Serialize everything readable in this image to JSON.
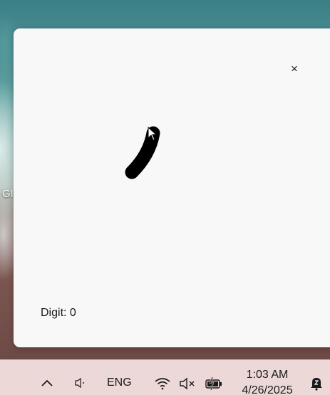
{
  "desktop": {
    "partial_icon_label": "GI"
  },
  "app": {
    "close_label": "×",
    "digit_prefix": "Digit:",
    "digit_value": "0",
    "digit_text": "Digit: 0"
  },
  "taskbar": {
    "language": "ENG",
    "time": "1:03 AM",
    "date": "4/26/2025",
    "icons": [
      "chevron-up-icon",
      "speaker-icon",
      "wifi-icon",
      "volume-mute-icon",
      "battery-charging-icon",
      "notification-sleep-icon"
    ]
  }
}
